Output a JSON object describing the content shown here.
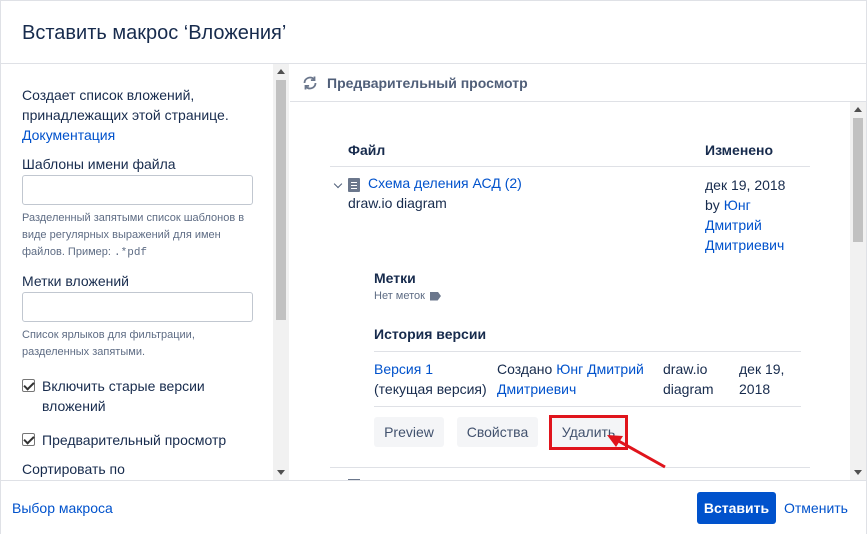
{
  "dialog": {
    "title": "Вставить макрос ‘Вложения’"
  },
  "left_panel": {
    "description": "Создает список вложений, принадлежащих этой странице.",
    "doc_link": "Документация",
    "filename_patterns": {
      "label": "Шаблоны имени файла",
      "value": "",
      "help_prefix": "Разделенный запятыми список шаблонов в виде регулярных выражений для имен файлов. Пример: ",
      "help_example": ".*pdf"
    },
    "attachment_labels": {
      "label": "Метки вложений",
      "value": "",
      "help": "Список ярлыков для фильтрации, разделенных запятыми."
    },
    "checkboxes": [
      {
        "label": "Включить старые версии вложений",
        "checked": true
      },
      {
        "label": "Предварительный просмотр",
        "checked": true
      }
    ],
    "sort_label": "Сортировать по"
  },
  "preview": {
    "header": "Предварительный просмотр",
    "columns": {
      "file": "Файл",
      "modified": "Изменено"
    },
    "attachment": {
      "name": "Схема деления АСД (2)",
      "type": "draw.io diagram",
      "date": "дек 19, 2018",
      "by": "by",
      "author": "Юнг Дмитрий Дмитриевич"
    },
    "labels_section": {
      "title": "Метки",
      "empty": "Нет меток"
    },
    "history_section": {
      "title": "История версии",
      "version_link": "Версия 1",
      "version_note": "(текущая версия)",
      "created_by_prefix": "Создано",
      "created_by_author": "Юнг Дмитрий Дмитриевич",
      "type": "draw.io diagram",
      "date": "дек 19, 2018"
    },
    "actions": {
      "preview": "Preview",
      "properties": "Свойства",
      "delete": "Удалить"
    }
  },
  "footer": {
    "macro_browser": "Выбор макроса",
    "insert": "Вставить",
    "cancel": "Отменить"
  },
  "colors": {
    "link": "#0052cc",
    "primary": "#0052cc",
    "highlight": "#e0141c"
  }
}
